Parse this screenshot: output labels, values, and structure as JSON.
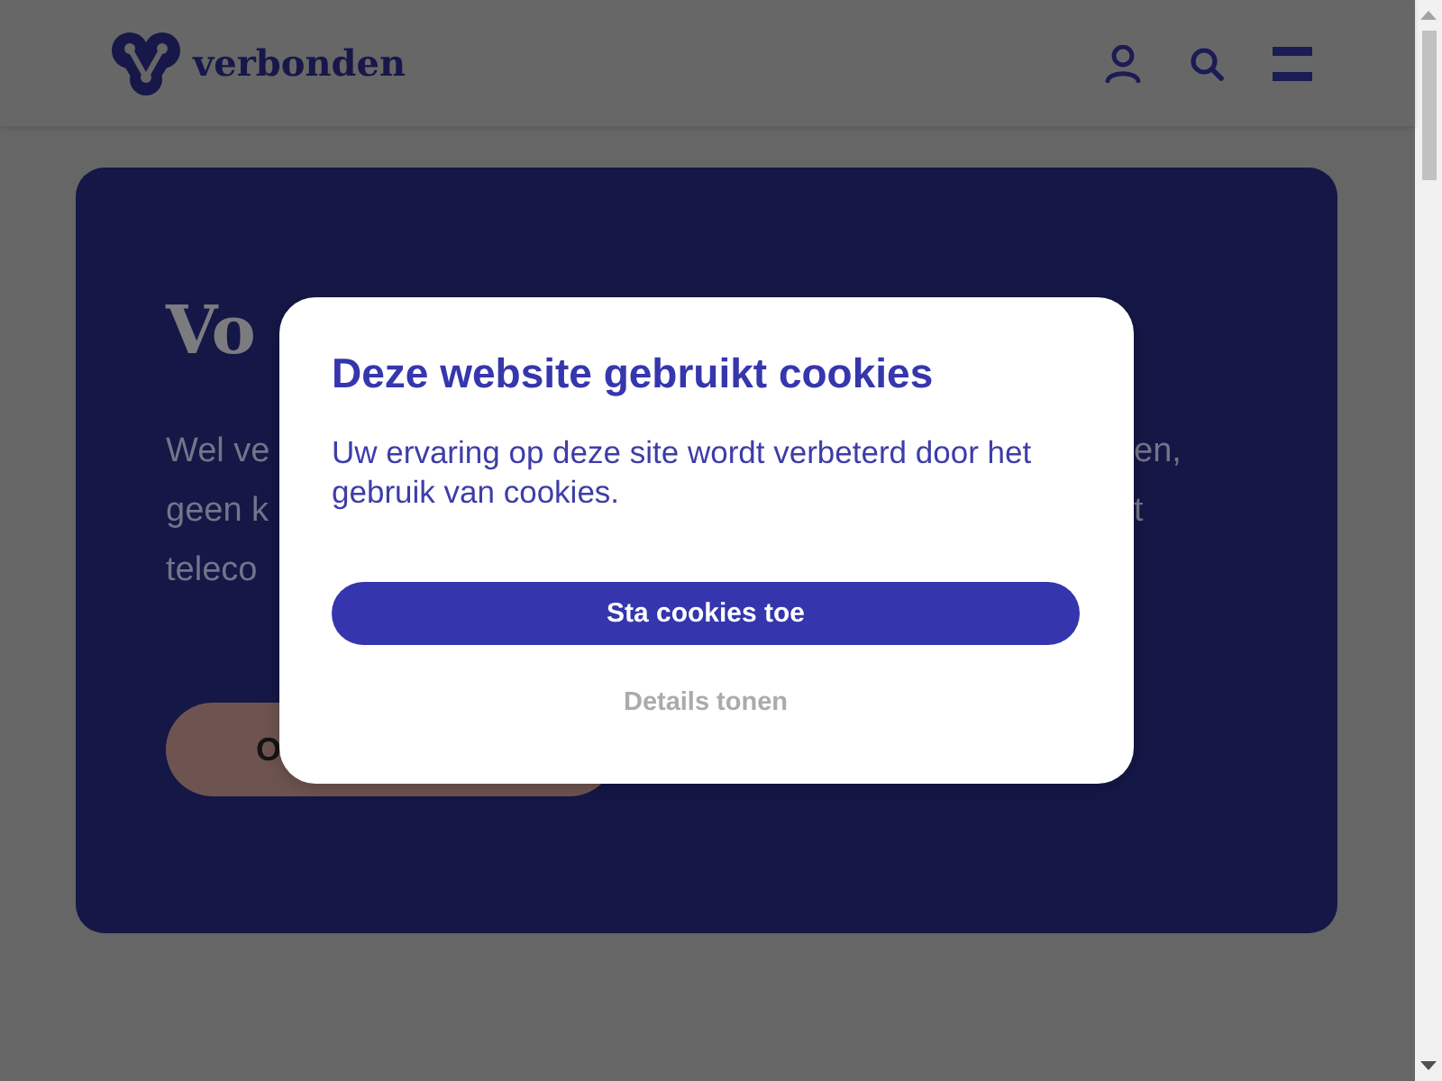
{
  "header": {
    "logo_text": "verbonden"
  },
  "hero": {
    "title": "Vo",
    "text_lines": [
      {
        "left": "Wel ve",
        "right": "en,"
      },
      {
        "left": "geen k",
        "right": "t"
      },
      {
        "left": "teleco"
      }
    ],
    "button": "O"
  },
  "cookie_dialog": {
    "title": "Deze website gebruikt cookies",
    "message": "Uw ervaring op deze site wordt verbeterd door het gebruik van cookies.",
    "buttons": [
      {
        "label": "Sta cookies toe",
        "kind": "primary"
      },
      {
        "label": "Details tonen",
        "kind": "link"
      }
    ]
  }
}
